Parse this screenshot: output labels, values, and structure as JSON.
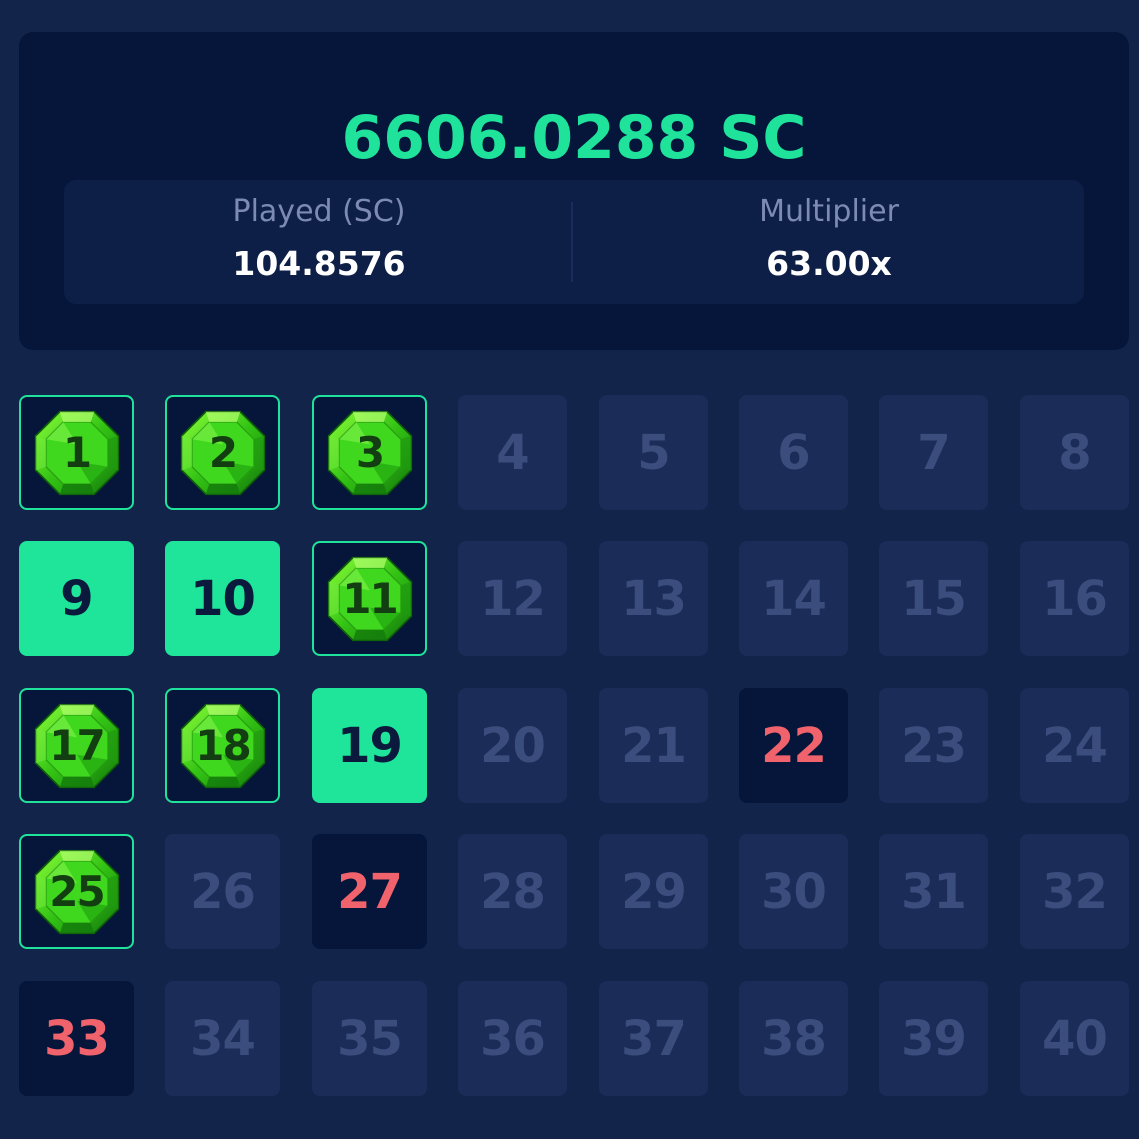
{
  "payout": {
    "amount": "6606.0288 SC"
  },
  "stats": {
    "played_label": "Played (SC)",
    "played_value": "104.8576",
    "multiplier_label": "Multiplier",
    "multiplier_value": "63.00x"
  },
  "colors": {
    "accent_green": "#1fe39a",
    "miss_red": "#f0636c",
    "background": "#13244a",
    "panel": "#05163a",
    "tile_unrevealed": "#1a2c57",
    "tile_number_muted": "#3b4d7d"
  },
  "board": {
    "columns": 8,
    "tiles": [
      {
        "label": "1",
        "state": "gem"
      },
      {
        "label": "2",
        "state": "gem"
      },
      {
        "label": "3",
        "state": "gem"
      },
      {
        "label": "4",
        "state": "unrevealed"
      },
      {
        "label": "5",
        "state": "unrevealed"
      },
      {
        "label": "6",
        "state": "unrevealed"
      },
      {
        "label": "7",
        "state": "unrevealed"
      },
      {
        "label": "8",
        "state": "unrevealed"
      },
      {
        "label": "9",
        "state": "picked"
      },
      {
        "label": "10",
        "state": "picked"
      },
      {
        "label": "11",
        "state": "gem"
      },
      {
        "label": "12",
        "state": "unrevealed"
      },
      {
        "label": "13",
        "state": "unrevealed"
      },
      {
        "label": "14",
        "state": "unrevealed"
      },
      {
        "label": "15",
        "state": "unrevealed"
      },
      {
        "label": "16",
        "state": "unrevealed"
      },
      {
        "label": "17",
        "state": "gem"
      },
      {
        "label": "18",
        "state": "gem"
      },
      {
        "label": "19",
        "state": "picked"
      },
      {
        "label": "20",
        "state": "unrevealed"
      },
      {
        "label": "21",
        "state": "unrevealed"
      },
      {
        "label": "22",
        "state": "miss"
      },
      {
        "label": "23",
        "state": "unrevealed"
      },
      {
        "label": "24",
        "state": "unrevealed"
      },
      {
        "label": "25",
        "state": "gem"
      },
      {
        "label": "26",
        "state": "unrevealed"
      },
      {
        "label": "27",
        "state": "miss"
      },
      {
        "label": "28",
        "state": "unrevealed"
      },
      {
        "label": "29",
        "state": "unrevealed"
      },
      {
        "label": "30",
        "state": "unrevealed"
      },
      {
        "label": "31",
        "state": "unrevealed"
      },
      {
        "label": "32",
        "state": "unrevealed"
      },
      {
        "label": "33",
        "state": "miss"
      },
      {
        "label": "34",
        "state": "unrevealed"
      },
      {
        "label": "35",
        "state": "unrevealed"
      },
      {
        "label": "36",
        "state": "unrevealed"
      },
      {
        "label": "37",
        "state": "unrevealed"
      },
      {
        "label": "38",
        "state": "unrevealed"
      },
      {
        "label": "39",
        "state": "unrevealed"
      },
      {
        "label": "40",
        "state": "unrevealed"
      }
    ],
    "gem_icon": "emerald-gem-icon"
  }
}
